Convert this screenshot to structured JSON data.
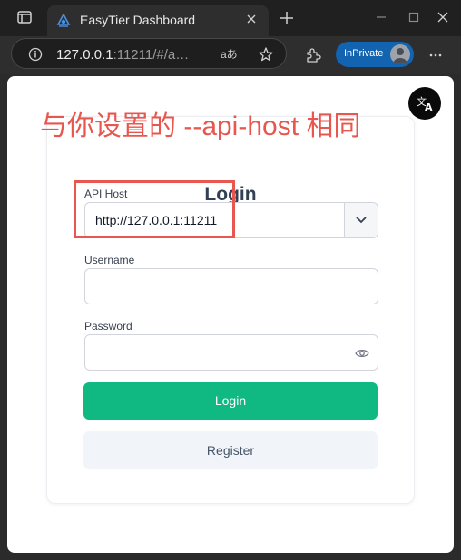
{
  "browser": {
    "tab_title": "EasyTier Dashboard",
    "url_host": "127.0.0.1",
    "url_rest": ":11211/#/a…",
    "read_aloud_label": "aあ",
    "inprivate_label": "InPrivate"
  },
  "annotation": {
    "text": "与你设置的 --api-host 相同",
    "color": "#e8574f"
  },
  "login_form": {
    "title": "Login",
    "api_host": {
      "label": "API Host",
      "value": "http://127.0.0.1:11211"
    },
    "username": {
      "label": "Username",
      "value": ""
    },
    "password": {
      "label": "Password",
      "value": ""
    },
    "login_button": "Login",
    "register_button": "Register"
  },
  "colors": {
    "primary": "#10b981",
    "inprivate": "#1263b0",
    "annotation": "#e8574f"
  },
  "icons": [
    "window-icon",
    "easytier-favicon",
    "close-icon",
    "new-tab-icon",
    "minimize-icon",
    "maximize-icon",
    "window-close-icon",
    "info-icon",
    "favorites-icon",
    "extensions-icon",
    "more-icon",
    "translate-icon",
    "chevron-down-icon",
    "eye-icon"
  ]
}
